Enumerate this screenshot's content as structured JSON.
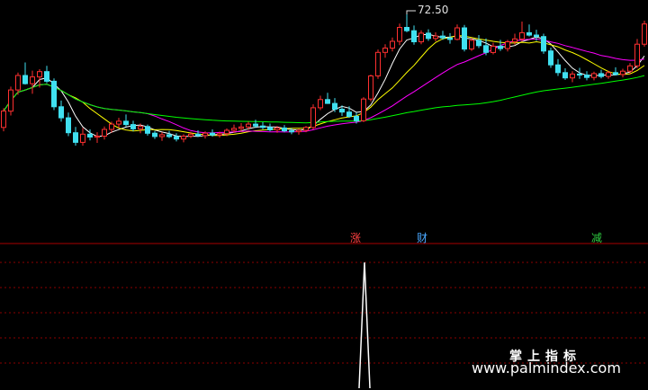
{
  "chart_data": {
    "type": "candlestick",
    "high_label": "72.50",
    "markers": [
      {
        "text": "涨",
        "color": "#ff4040"
      },
      {
        "text": "财",
        "color": "#4aa8ff"
      },
      {
        "text": "减",
        "color": "#2ecc40"
      }
    ],
    "ohlc": [
      [
        49.0,
        53.0,
        48.2,
        52.4
      ],
      [
        52.4,
        57.5,
        51.5,
        56.8
      ],
      [
        56.8,
        60.4,
        55.8,
        59.8
      ],
      [
        59.8,
        62.5,
        57.9,
        58.1
      ],
      [
        58.1,
        60.8,
        56.0,
        59.5
      ],
      [
        59.5,
        61.1,
        57.3,
        60.6
      ],
      [
        60.6,
        61.8,
        58.2,
        58.6
      ],
      [
        58.6,
        59.2,
        52.6,
        53.3
      ],
      [
        53.3,
        54.6,
        50.2,
        51.0
      ],
      [
        51.0,
        52.1,
        47.2,
        47.9
      ],
      [
        47.9,
        49.1,
        45.2,
        45.9
      ],
      [
        45.9,
        48.9,
        45.2,
        47.6
      ],
      [
        47.6,
        48.6,
        46.3,
        47.0
      ],
      [
        47.0,
        48.0,
        45.8,
        47.2
      ],
      [
        47.2,
        49.2,
        46.5,
        48.6
      ],
      [
        48.6,
        50.2,
        47.9,
        49.7
      ],
      [
        49.7,
        51.0,
        48.9,
        50.3
      ],
      [
        50.3,
        51.7,
        49.2,
        49.6
      ],
      [
        49.6,
        50.4,
        48.2,
        48.7
      ],
      [
        48.7,
        49.8,
        47.8,
        49.2
      ],
      [
        49.2,
        49.6,
        47.3,
        47.8
      ],
      [
        47.8,
        48.3,
        46.6,
        47.1
      ],
      [
        47.1,
        48.0,
        46.2,
        47.5
      ],
      [
        47.5,
        48.3,
        46.8,
        47.1
      ],
      [
        47.1,
        47.8,
        46.1,
        46.6
      ],
      [
        46.6,
        47.6,
        45.9,
        47.2
      ],
      [
        47.2,
        48.1,
        46.8,
        47.6
      ],
      [
        47.6,
        48.4,
        47.0,
        47.3
      ],
      [
        47.3,
        48.2,
        46.7,
        47.8
      ],
      [
        47.8,
        48.6,
        47.1,
        47.4
      ],
      [
        47.4,
        48.1,
        46.9,
        47.7
      ],
      [
        47.7,
        48.8,
        47.2,
        48.4
      ],
      [
        48.4,
        49.6,
        47.9,
        48.8
      ],
      [
        48.8,
        49.9,
        48.1,
        49.1
      ],
      [
        49.1,
        50.2,
        48.5,
        49.7
      ],
      [
        49.7,
        50.6,
        48.9,
        49.3
      ],
      [
        49.3,
        50.1,
        48.6,
        49.0
      ],
      [
        49.0,
        49.8,
        48.2,
        48.5
      ],
      [
        48.5,
        49.3,
        47.9,
        48.9
      ],
      [
        48.9,
        49.5,
        48.0,
        48.3
      ],
      [
        48.3,
        48.9,
        47.6,
        48.1
      ],
      [
        48.1,
        48.7,
        47.5,
        48.4
      ],
      [
        48.4,
        49.3,
        48.0,
        49.0
      ],
      [
        49.0,
        53.8,
        48.6,
        53.1
      ],
      [
        53.1,
        55.6,
        52.6,
        54.8
      ],
      [
        54.8,
        56.2,
        53.9,
        54.0
      ],
      [
        54.0,
        55.1,
        52.2,
        52.8
      ],
      [
        52.8,
        53.6,
        51.4,
        52.2
      ],
      [
        52.2,
        53.4,
        51.0,
        51.3
      ],
      [
        51.3,
        52.1,
        49.8,
        50.4
      ],
      [
        50.4,
        55.3,
        50.1,
        54.9
      ],
      [
        54.9,
        60.0,
        54.4,
        59.7
      ],
      [
        59.7,
        65.2,
        59.1,
        64.6
      ],
      [
        64.6,
        66.3,
        63.5,
        65.5
      ],
      [
        65.5,
        67.7,
        64.8,
        66.9
      ],
      [
        66.9,
        70.6,
        66.1,
        69.8
      ],
      [
        69.8,
        72.5,
        68.8,
        69.1
      ],
      [
        69.1,
        70.2,
        66.2,
        66.8
      ],
      [
        66.8,
        69.2,
        66.3,
        68.6
      ],
      [
        68.6,
        69.4,
        67.0,
        67.5
      ],
      [
        67.5,
        68.8,
        66.9,
        68.0
      ],
      [
        68.0,
        69.1,
        67.2,
        67.6
      ],
      [
        67.6,
        68.6,
        66.4,
        67.3
      ],
      [
        67.3,
        70.4,
        67.1,
        69.7
      ],
      [
        69.7,
        70.3,
        64.8,
        65.3
      ],
      [
        65.3,
        67.6,
        64.9,
        67.1
      ],
      [
        67.1,
        68.2,
        65.5,
        66.0
      ],
      [
        66.0,
        67.5,
        64.0,
        64.6
      ],
      [
        64.6,
        66.6,
        64.2,
        65.9
      ],
      [
        65.9,
        67.2,
        64.9,
        65.4
      ],
      [
        65.4,
        67.2,
        64.8,
        66.8
      ],
      [
        66.8,
        68.5,
        66.2,
        67.4
      ],
      [
        67.4,
        71.0,
        66.8,
        68.7
      ],
      [
        68.7,
        70.4,
        67.9,
        68.2
      ],
      [
        68.2,
        69.3,
        67.0,
        67.9
      ],
      [
        67.9,
        68.5,
        64.3,
        64.9
      ],
      [
        64.9,
        65.6,
        61.4,
        62.0
      ],
      [
        62.0,
        63.2,
        59.7,
        60.4
      ],
      [
        60.4,
        61.3,
        58.9,
        59.3
      ],
      [
        59.3,
        60.7,
        58.4,
        60.1
      ],
      [
        60.1,
        61.4,
        59.1,
        59.9
      ],
      [
        59.9,
        60.7,
        58.8,
        59.4
      ],
      [
        59.4,
        60.6,
        58.8,
        60.2
      ],
      [
        60.2,
        61.0,
        59.2,
        59.6
      ],
      [
        59.6,
        60.8,
        59.1,
        60.4
      ],
      [
        60.4,
        61.5,
        59.8,
        60.0
      ],
      [
        60.0,
        61.2,
        59.4,
        60.7
      ],
      [
        60.7,
        62.4,
        60.1,
        61.8
      ],
      [
        61.8,
        67.4,
        61.3,
        66.3
      ],
      [
        66.3,
        71.2,
        65.8,
        70.5
      ]
    ],
    "signal": [
      0,
      0,
      0,
      0,
      0,
      0,
      0,
      0,
      0,
      0,
      0,
      0,
      0,
      0,
      0,
      0,
      0,
      0,
      0,
      0,
      0,
      0,
      0,
      0,
      0,
      0,
      0,
      0,
      0,
      0,
      0,
      0,
      0,
      0,
      0,
      0,
      0,
      0,
      0,
      0,
      0,
      0,
      0,
      0,
      0,
      0,
      0,
      0,
      0,
      0,
      0,
      0,
      0,
      0,
      0,
      0,
      0,
      0,
      0,
      0,
      0,
      0,
      0,
      0,
      0,
      0,
      0,
      0,
      0,
      0,
      0,
      0,
      0,
      0,
      0,
      0,
      0,
      0,
      0,
      0,
      0,
      0,
      0,
      0,
      0,
      0,
      0,
      0,
      0,
      0,
      0,
      0,
      0,
      0,
      0,
      0,
      0,
      0,
      0,
      0,
      0,
      0,
      0,
      0,
      0,
      0,
      0,
      0,
      0,
      0,
      0,
      0,
      0,
      0,
      0,
      0,
      0,
      0,
      0,
      0
    ],
    "ma_periods": [
      5,
      10,
      20,
      60
    ],
    "ma_colors": [
      "#ffffff",
      "#ffff00",
      "#ff00ff",
      "#00ff00"
    ],
    "colors": {
      "up": "#ff3030",
      "down": "#40e0f0",
      "grid": "#8b0000",
      "signal": "#ffffff"
    }
  },
  "watermark": {
    "title": "掌上指标",
    "url": "www.palmindex.com"
  }
}
